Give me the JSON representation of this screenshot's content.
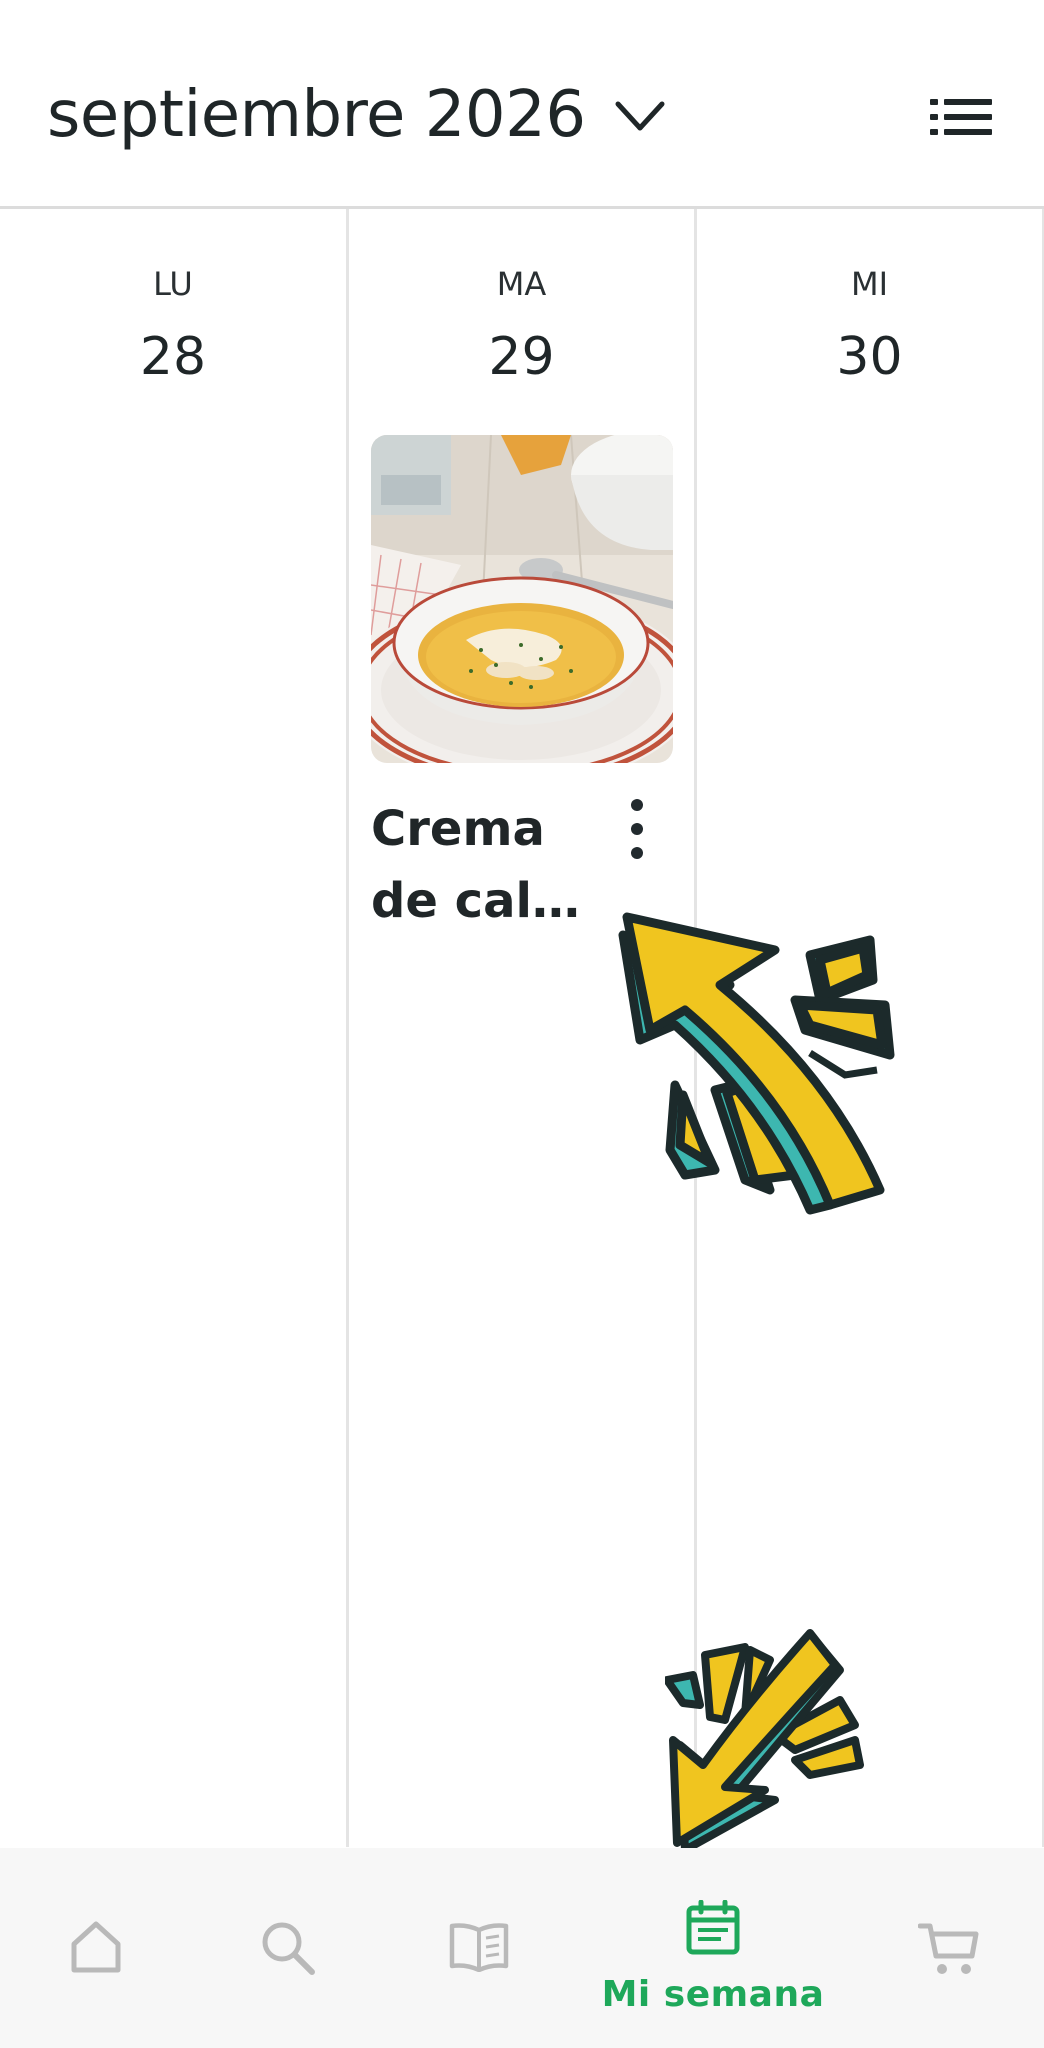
{
  "header": {
    "month_title": "septiembre 2026",
    "chevron_icon": "chevron-down-icon",
    "list_icon": "list-view-icon"
  },
  "week": {
    "days": [
      {
        "label": "LU",
        "number": "28"
      },
      {
        "label": "MA",
        "number": "29"
      },
      {
        "label": "MI",
        "number": "30"
      }
    ],
    "recipe": {
      "title": "Crema de cal…",
      "image": "pumpkin-cream-soup-photo",
      "menu_icon": "more-vertical-icon"
    }
  },
  "bottom_nav": {
    "items": [
      {
        "icon": "home-icon",
        "label": ""
      },
      {
        "icon": "search-icon",
        "label": ""
      },
      {
        "icon": "book-icon",
        "label": ""
      },
      {
        "icon": "calendar-icon",
        "label": "Mi semana",
        "active": true
      },
      {
        "icon": "cart-icon",
        "label": ""
      }
    ],
    "active_color": "#1ea85a",
    "inactive_color": "#b9b9b9"
  },
  "colors": {
    "arrow_yellow": "#f0c51f",
    "arrow_teal": "#3db7b0",
    "outline": "#1c2a2b"
  }
}
